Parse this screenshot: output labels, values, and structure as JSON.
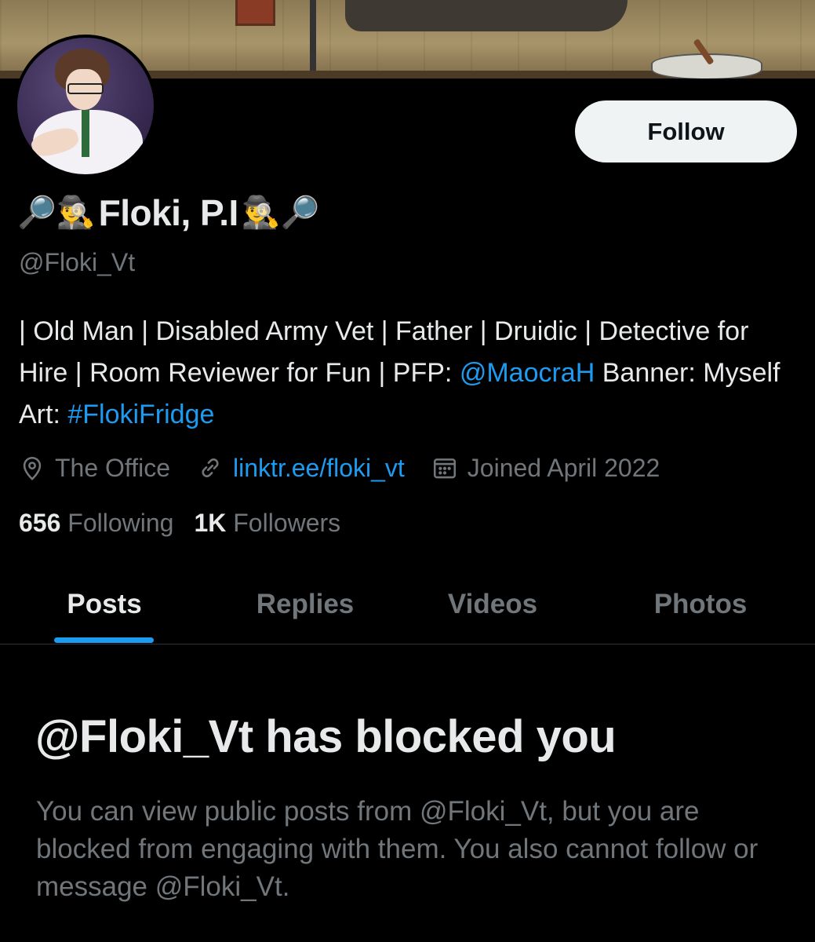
{
  "profile": {
    "name_prefix_emojis": [
      "🔎",
      "🕵️‍♂️"
    ],
    "display_name": "Floki, P.I",
    "name_suffix_emojis": [
      "🕵️‍♂️",
      "🔎"
    ],
    "handle": "@Floki_Vt",
    "follow_label": "Follow",
    "bio": {
      "text1": "| Old Man | Disabled Army Vet | Father | Druidic | Detective for Hire | Room Reviewer for Fun | PFP: ",
      "mention": "@MaocraH",
      "text2": " Banner: Myself Art: ",
      "hashtag": "#FlokiFridge"
    },
    "location": "The Office",
    "website": "linktr.ee/floki_vt",
    "joined": "Joined April 2022",
    "following_count": "656",
    "following_label": "Following",
    "followers_count": "1K",
    "followers_label": "Followers"
  },
  "tabs": [
    {
      "label": "Posts",
      "active": true
    },
    {
      "label": "Replies",
      "active": false
    },
    {
      "label": "Videos",
      "active": false
    },
    {
      "label": "Photos",
      "active": false
    }
  ],
  "blocked": {
    "title": "@Floki_Vt has blocked you",
    "description": "You can view public posts from @Floki_Vt, but you are blocked from engaging with them. You also cannot follow or message @Floki_Vt."
  },
  "icons": {
    "location": "location-pin-icon",
    "website": "link-icon",
    "joined": "calendar-icon"
  },
  "colors": {
    "background": "#000000",
    "primary_text": "#e7e9ea",
    "secondary_text": "#71767b",
    "accent": "#1d9bf0",
    "button_bg": "#eff3f4"
  }
}
